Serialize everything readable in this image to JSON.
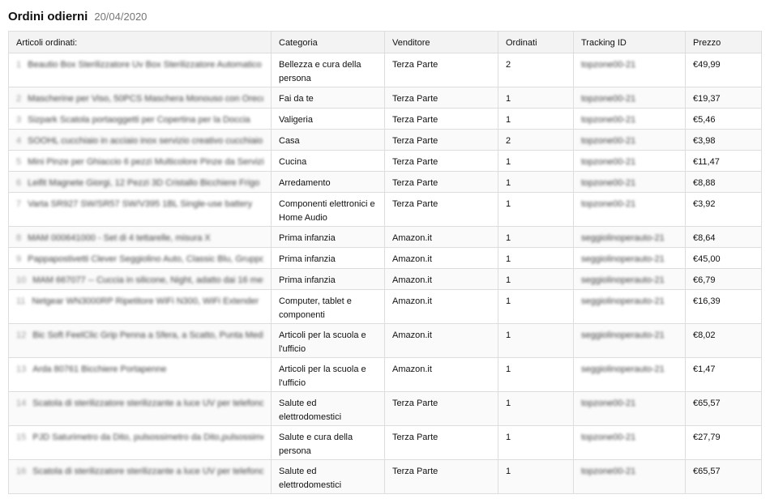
{
  "header": {
    "title": "Ordini odierni",
    "date": "20/04/2020"
  },
  "columns": [
    "Articoli ordinati:",
    "Categoria",
    "Venditore",
    "Ordinati",
    "Tracking ID",
    "Prezzo"
  ],
  "rows": [
    {
      "num": "1",
      "item": "Beautio Box Sterilizzatore Uv Box Sterilizzatore Automatico",
      "category": "Bellezza e cura della persona",
      "seller": "Terza Parte",
      "qty": "2",
      "tracking": "topzone00-21",
      "price": "€49,99",
      "h": 42
    },
    {
      "num": "2",
      "item": "Mascherine per Viso, 50PCS Maschera Monouso con Orecchio",
      "category": "Fai da te",
      "seller": "Terza Parte",
      "qty": "1",
      "tracking": "topzone00-21",
      "price": "€19,37",
      "h": 26
    },
    {
      "num": "3",
      "item": "Sizpark Scatola portaoggetti per Copertina per la Doccia",
      "category": "Valigeria",
      "seller": "Terza Parte",
      "qty": "1",
      "tracking": "topzone00-21",
      "price": "€5,46",
      "h": 26
    },
    {
      "num": "4",
      "item": "SOOHL cucchiaio in acciaio inox servizio creativo cucchiaio",
      "category": "Casa",
      "seller": "Terza Parte",
      "qty": "2",
      "tracking": "topzone00-21",
      "price": "€3,98",
      "h": 26
    },
    {
      "num": "5",
      "item": "Mini Pinze per Ghiaccio 6 pezzi Multicolore Pinze da Servizio",
      "category": "Cucina",
      "seller": "Terza Parte",
      "qty": "1",
      "tracking": "topzone00-21",
      "price": "€11,47",
      "h": 26
    },
    {
      "num": "6",
      "item": "Leifit Magnete Giorgi, 12 Pezzi 3D Cristallo Bicchiere Frigo",
      "category": "Arredamento",
      "seller": "Terza Parte",
      "qty": "1",
      "tracking": "topzone00-21",
      "price": "€8,88",
      "h": 26
    },
    {
      "num": "7",
      "item": "Varta SR927 SW/SR57 SW/V395 1BL Single-use battery",
      "category": "Componenti elettronici e Home Audio",
      "seller": "Terza Parte",
      "qty": "1",
      "tracking": "topzone00-21",
      "price": "€3,92",
      "h": 42
    },
    {
      "num": "8",
      "item": "MAM 000641000 - Set di 4 tettarelle, misura X",
      "category": "Prima infanzia",
      "seller": "Amazon.it",
      "qty": "1",
      "tracking": "seggiolinoperauto-21",
      "price": "€8,64",
      "h": 26
    },
    {
      "num": "9",
      "item": "Pappapostivetti Clever Seggiolino Auto, Classic Blu, Gruppo",
      "category": "Prima infanzia",
      "seller": "Amazon.it",
      "qty": "1",
      "tracking": "seggiolinoperauto-21",
      "price": "€45,00",
      "h": 26
    },
    {
      "num": "10",
      "item": "MAM 667077 -- Cuccia in silicone, Night, adatto dai 16 mesi",
      "category": "Prima infanzia",
      "seller": "Amazon.it",
      "qty": "1",
      "tracking": "seggiolinoperauto-21",
      "price": "€6,79",
      "h": 26
    },
    {
      "num": "11",
      "item": "Netgear WN3000RP Ripetitore WiFi N300, WiFi Extender",
      "category": "Computer, tablet e componenti",
      "seller": "Amazon.it",
      "qty": "1",
      "tracking": "seggiolinoperauto-21",
      "price": "€16,39",
      "h": 42
    },
    {
      "num": "12",
      "item": "Bic Soft FeelClic Grip Penna a Sfera, a Scatto, Punta Media",
      "category": "Articoli per la scuola e l'ufficio",
      "seller": "Amazon.it",
      "qty": "1",
      "tracking": "seggiolinoperauto-21",
      "price": "€8,02",
      "h": 42
    },
    {
      "num": "13",
      "item": "Arda 80761 Bicchiere Portapenne",
      "category": "Articoli per la scuola e l'ufficio",
      "seller": "Amazon.it",
      "qty": "1",
      "tracking": "seggiolinoperauto-21",
      "price": "€1,47",
      "h": 42
    },
    {
      "num": "14",
      "item": "Scatola di sterilizzatore sterilizzante a luce UV per telefono",
      "category": "Salute ed elettrodomestici",
      "seller": "Terza Parte",
      "qty": "1",
      "tracking": "topzone00-21",
      "price": "€65,57",
      "h": 42
    },
    {
      "num": "15",
      "item": "PJD Saturimetro da Dito, pulsossimetro da Dito,pulsossimetro",
      "category": "Salute e cura della persona",
      "seller": "Terza Parte",
      "qty": "1",
      "tracking": "topzone00-21",
      "price": "€27,79",
      "h": 42
    },
    {
      "num": "16",
      "item": "Scatola di sterilizzatore sterilizzante a luce UV per telefono",
      "category": "Salute ed elettrodomestici",
      "seller": "Terza Parte",
      "qty": "1",
      "tracking": "topzone00-21",
      "price": "€65,57",
      "h": 42
    }
  ]
}
